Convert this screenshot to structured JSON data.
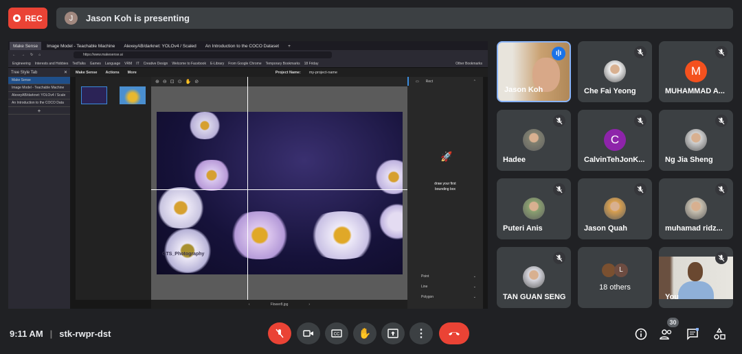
{
  "top": {
    "rec_label": "REC",
    "presenter_initial": "J",
    "presenter_text": "Jason Koh is presenting"
  },
  "shared_screen": {
    "browser_tabs": [
      "Make Sense",
      "Image Model - Teachable Machine",
      "AlexeyAB/darknet: YOLOv4 / Scaled",
      "An Introduction to the COCO Dataset"
    ],
    "url": "https://www.makesense.ai",
    "bookmarks": [
      "Engineering",
      "Interests and Hobbies",
      "TedTalks",
      "Games",
      "Language",
      "VRM",
      "IT",
      "Creative Design",
      "Welcome to Facebook",
      "E-Library",
      "From Google Chrome",
      "Temporary Bookmarks",
      "18 Friday"
    ],
    "other_bookmarks": "Other Bookmarks",
    "tree_style_tab": {
      "title": "Tree Style Tab",
      "items": [
        "Make Sense",
        "Image Model - Teachable Machine",
        "AlexeyAB/darknet: YOLOv4 / Scale",
        "An Introduction to the COCO Data"
      ]
    },
    "makesense": {
      "menu": [
        "Make Sense",
        "Actions",
        "More"
      ],
      "project_label": "Project Name:",
      "project_name": "my-project-name",
      "right_panel": {
        "rect": "Rect",
        "empty_text_1": "draw your first",
        "empty_text_2": "bounding box",
        "tools": [
          "Point",
          "Line",
          "Polygon"
        ]
      },
      "image_watermark": "GTS_Photography",
      "file_name": "Flower8.jpg"
    }
  },
  "participants": [
    {
      "name": "Jason Koh",
      "speaking": true
    },
    {
      "name": "Che Fai Yeong",
      "muted": true
    },
    {
      "name": "MUHAMMAD A...",
      "initial": "M",
      "color": "#f4511e",
      "muted": true
    },
    {
      "name": "Hadee",
      "muted": true
    },
    {
      "name": "CalvinTehJonK...",
      "initial": "C",
      "color": "#8e24aa",
      "muted": true
    },
    {
      "name": "Ng Jia Sheng",
      "muted": true
    },
    {
      "name": "Puteri Anis",
      "muted": true
    },
    {
      "name": "Jason Quah",
      "muted": true
    },
    {
      "name": "muhamad ridz...",
      "muted": true
    },
    {
      "name": "TAN GUAN SENG",
      "muted": true
    },
    {
      "name": "18 others",
      "initial": "L",
      "color": "#6d4c41"
    },
    {
      "name": "You",
      "muted": true
    }
  ],
  "bottom": {
    "time": "9:11 AM",
    "meeting_code": "stk-rwpr-dst",
    "participant_count": "30",
    "colors": {
      "danger": "#ea4335",
      "button": "#3c4043",
      "accent": "#8ab4f8"
    }
  }
}
